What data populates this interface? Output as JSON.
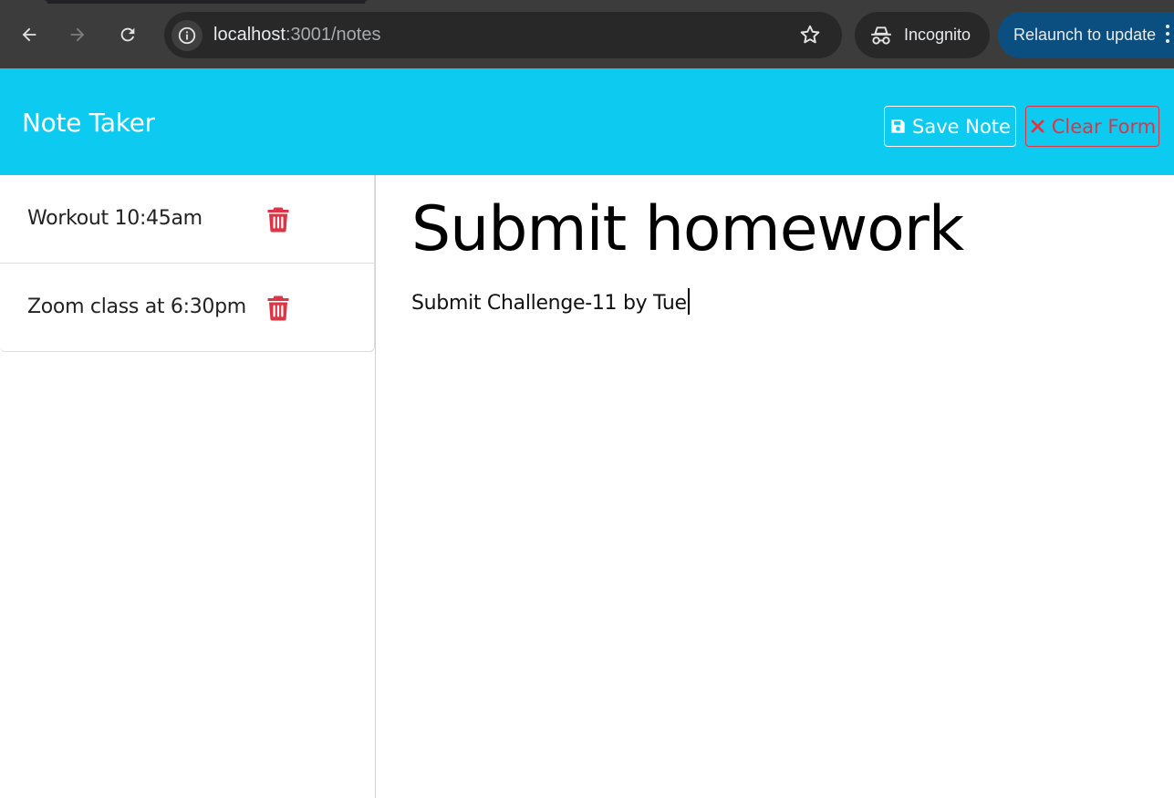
{
  "browser": {
    "url_host": "localhost",
    "url_path": ":3001/notes",
    "incognito_label": "Incognito",
    "relaunch_label": "Relaunch to update",
    "icons": {
      "back": "back-arrow-icon",
      "forward": "forward-arrow-icon",
      "reload": "reload-icon",
      "info": "info-icon",
      "star": "star-icon",
      "incognito": "incognito-icon",
      "menu": "more-vert-icon"
    }
  },
  "app": {
    "brand": "Note Taker",
    "save_label": "Save Note",
    "clear_label": "Clear Form",
    "colors": {
      "navbar": "#0dcaf0",
      "danger": "#dc3545"
    }
  },
  "notes": [
    {
      "title": "Workout 10:45am"
    },
    {
      "title": "Zoom class at 6:30pm"
    }
  ],
  "editor": {
    "title": "Submit homework",
    "text": "Submit Challenge-11 by Tue"
  }
}
